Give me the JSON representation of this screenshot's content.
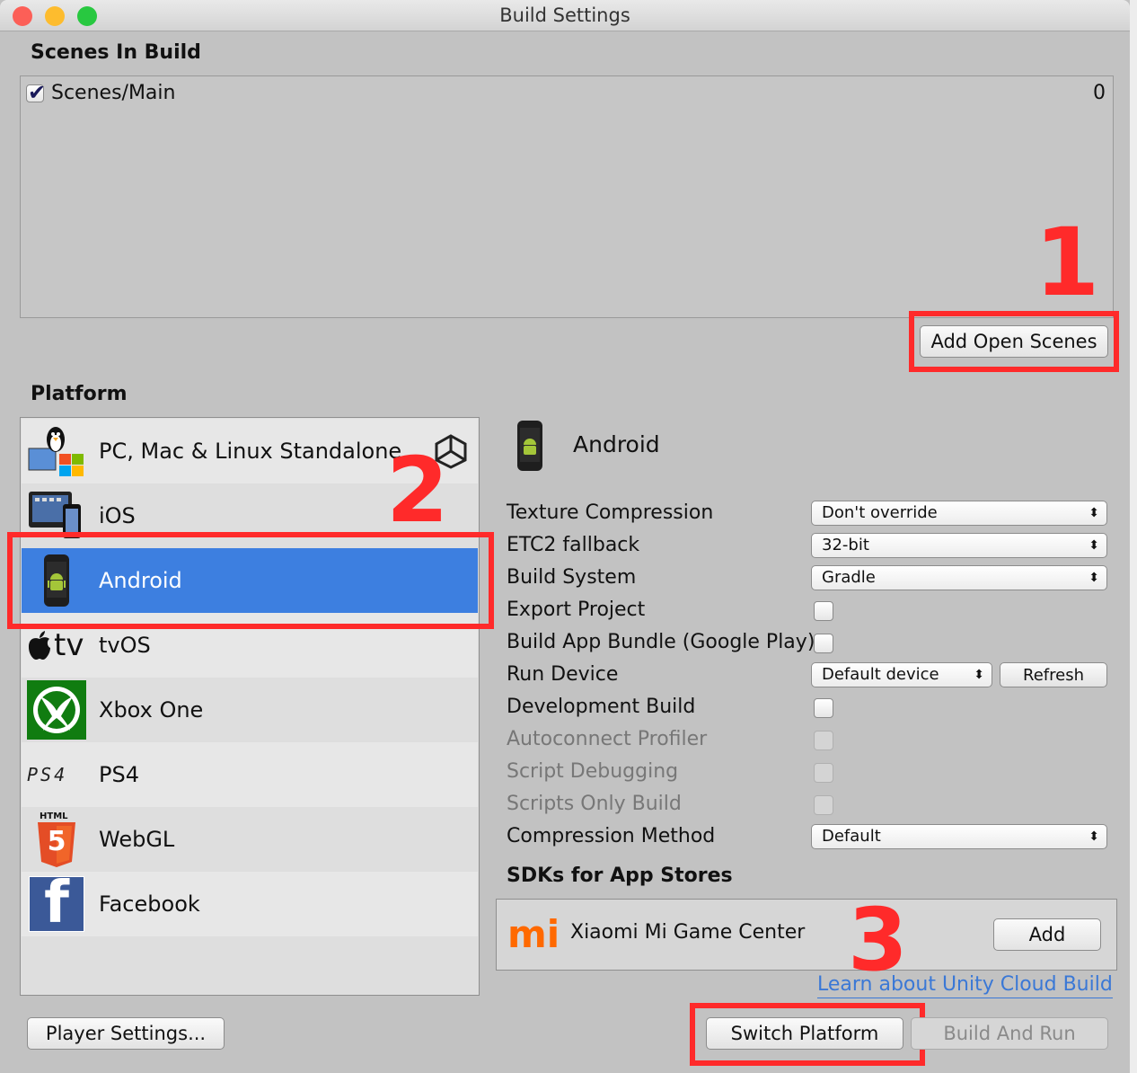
{
  "window": {
    "title": "Build Settings",
    "traffic_lights": [
      {
        "name": "close",
        "color": "#fc5f57"
      },
      {
        "name": "minimize",
        "color": "#fdbc2e"
      },
      {
        "name": "zoom",
        "color": "#28c840"
      }
    ]
  },
  "scenes": {
    "title": "Scenes In Build",
    "items": [
      {
        "path": "Scenes/Main",
        "index": "0",
        "checked": true
      }
    ],
    "add_button": "Add Open Scenes"
  },
  "platform": {
    "title": "Platform",
    "items": [
      {
        "label": "PC, Mac & Linux Standalone",
        "icon": "standalone-icon",
        "active_marker": "unity-logo-icon"
      },
      {
        "label": "iOS",
        "icon": "ios-icon"
      },
      {
        "label": "Android",
        "icon": "android-icon",
        "selected": true
      },
      {
        "label": "tvOS",
        "icon": "apple-tv-icon",
        "icon_text": "tv"
      },
      {
        "label": "Xbox One",
        "icon": "xbox-icon"
      },
      {
        "label": "PS4",
        "icon": "ps4-icon",
        "icon_text": "PS4"
      },
      {
        "label": "WebGL",
        "icon": "html5-icon",
        "icon_text": "HTML",
        "icon_digit": "5"
      },
      {
        "label": "Facebook",
        "icon": "facebook-icon",
        "icon_text": "f"
      }
    ]
  },
  "settings": {
    "platform_name": "Android",
    "rows": [
      {
        "label": "Texture Compression",
        "control": "dropdown",
        "value": "Don't override"
      },
      {
        "label": "ETC2 fallback",
        "control": "dropdown",
        "value": "32-bit"
      },
      {
        "label": "Build System",
        "control": "dropdown",
        "value": "Gradle"
      },
      {
        "label": "Export Project",
        "control": "checkbox"
      },
      {
        "label": "Build App Bundle (Google Play)",
        "control": "checkbox"
      },
      {
        "label": "Run Device",
        "control": "dropdown",
        "value": "Default device",
        "button": "Refresh"
      },
      {
        "label": "Development Build",
        "control": "checkbox"
      },
      {
        "label": "Autoconnect Profiler",
        "control": "checkbox",
        "disabled": true
      },
      {
        "label": "Script Debugging",
        "control": "checkbox",
        "disabled": true
      },
      {
        "label": "Scripts Only Build",
        "control": "checkbox",
        "disabled": true
      },
      {
        "label": "Compression Method",
        "control": "dropdown",
        "value": "Default"
      }
    ],
    "dropdown_arrows": "▲▼"
  },
  "sdks": {
    "title": "SDKs for App Stores",
    "items": [
      {
        "name": "Xiaomi Mi Game Center",
        "logo_text": "mi",
        "button": "Add"
      }
    ],
    "cloud_link": "Learn about Unity Cloud Build"
  },
  "footer": {
    "player_settings": "Player Settings...",
    "switch_platform": "Switch Platform",
    "build_and_run": "Build And Run"
  },
  "annotations": [
    "1",
    "2",
    "3"
  ],
  "colors": {
    "accent_red": "#ff2a2a",
    "selection_blue": "#3d7fe0",
    "link_blue": "#3a78d6"
  }
}
